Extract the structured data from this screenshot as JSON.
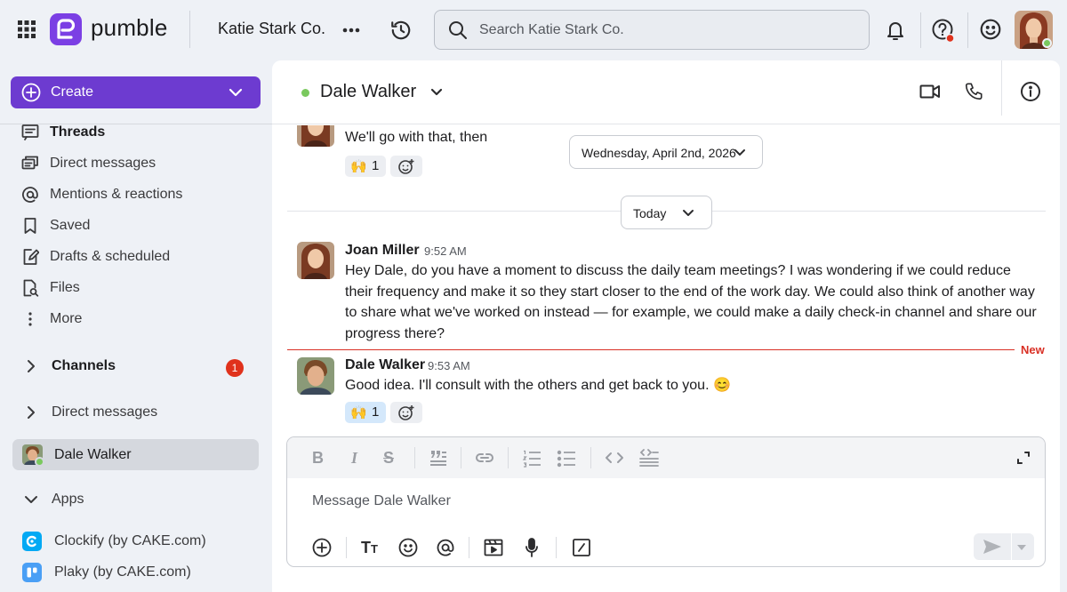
{
  "topbar": {
    "brand_name": "pumble",
    "workspace_name": "Katie Stark Co.",
    "search_placeholder": "Search Katie Stark Co."
  },
  "sidebar": {
    "create_label": "Create",
    "nav": [
      {
        "label": "Threads",
        "icon": "threads-icon"
      },
      {
        "label": "Direct messages",
        "icon": "direct-messages-icon"
      },
      {
        "label": "Mentions & reactions",
        "icon": "mention-icon"
      },
      {
        "label": "Saved",
        "icon": "bookmark-icon"
      },
      {
        "label": "Drafts & scheduled",
        "icon": "draft-icon"
      },
      {
        "label": "Files",
        "icon": "file-search-icon"
      },
      {
        "label": "More",
        "icon": "more-vertical-icon"
      }
    ],
    "channels_label": "Channels",
    "channels_badge": "1",
    "dm_section_label": "Direct messages",
    "dm_active": "Dale Walker",
    "apps_label": "Apps",
    "apps": [
      {
        "label": "Clockify (by CAKE.com)",
        "color": "#03a9f4"
      },
      {
        "label": "Plaky (by CAKE.com)",
        "color": "#4a9ff5"
      }
    ]
  },
  "conversation": {
    "title": "Dale Walker",
    "date_pill": "Wednesday, April 2nd, 2026",
    "today_pill": "Today",
    "new_marker": "New",
    "messages": [
      {
        "text": "We'll go with that, then",
        "reaction_emoji": "🙌",
        "reaction_count": "1"
      },
      {
        "author": "Joan Miller",
        "time": "9:52 AM",
        "text": "Hey Dale, do you have a moment to discuss the daily team meetings? I was wondering if we could reduce their frequency and make it so they start closer to the end of the work day. We could also think of another way to share what we've worked on instead — for example, we could make a daily check-in channel and share our progress there?"
      },
      {
        "author": "Dale Walker",
        "time": "9:53 AM",
        "text": "Good idea. I'll consult with the others and get back to you. 😊",
        "reaction_emoji": "🙌",
        "reaction_count": "1"
      }
    ]
  },
  "composer": {
    "placeholder": "Message Dale Walker"
  },
  "colors": {
    "brand": "#6d3bd0",
    "presence": "#7ac95e",
    "badge": "#e0321c",
    "new_marker": "#d93025"
  }
}
